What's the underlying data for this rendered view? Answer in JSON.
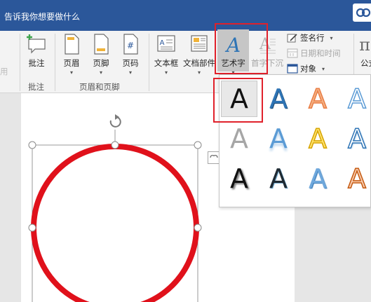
{
  "title_bar": {
    "tell_me": "告诉我你想要做什么"
  },
  "ribbon": {
    "cut_left_label": "用",
    "buttons": {
      "comment": "批注",
      "header": "页眉",
      "footer": "页脚",
      "page_number": "页码",
      "text_box": "文本框",
      "quick_parts": "文档部件",
      "word_art": "艺术字",
      "drop_cap": "首字下沉",
      "signature_line": "签名行",
      "date_time": "日期和时间",
      "object": "对象",
      "equation_cut": "公式"
    },
    "groups": {
      "comments": "批注",
      "header_footer": "页眉和页脚"
    }
  },
  "wordart_gallery": {
    "items": [
      "A",
      "A",
      "A",
      "A",
      "A",
      "A",
      "A",
      "A",
      "A",
      "A",
      "A",
      "A"
    ],
    "selected_index": 0
  },
  "colors": {
    "title_bar": "#2b579a",
    "highlight_box": "#e0212b",
    "circle_stroke": "#e0111b"
  }
}
